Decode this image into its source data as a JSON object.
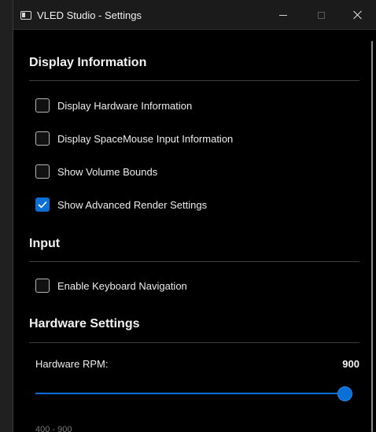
{
  "window": {
    "title": "VLED Studio - Settings"
  },
  "sections": {
    "display": {
      "title": "Display Information",
      "items": [
        {
          "label": "Display Hardware Information",
          "checked": false
        },
        {
          "label": "Display SpaceMouse Input Information",
          "checked": false
        },
        {
          "label": "Show Volume Bounds",
          "checked": false
        },
        {
          "label": "Show Advanced Render Settings",
          "checked": true
        }
      ]
    },
    "input": {
      "title": "Input",
      "items": [
        {
          "label": "Enable Keyboard Navigation",
          "checked": false
        }
      ]
    },
    "hardware": {
      "title": "Hardware Settings",
      "rpm_label": "Hardware RPM:",
      "rpm_value": "900",
      "rpm_level": 1.0,
      "range_hint": "400 - 900"
    }
  },
  "colors": {
    "accent": "#0a6fd6",
    "background": "#000000",
    "titlebar": "#1b1b1b"
  }
}
